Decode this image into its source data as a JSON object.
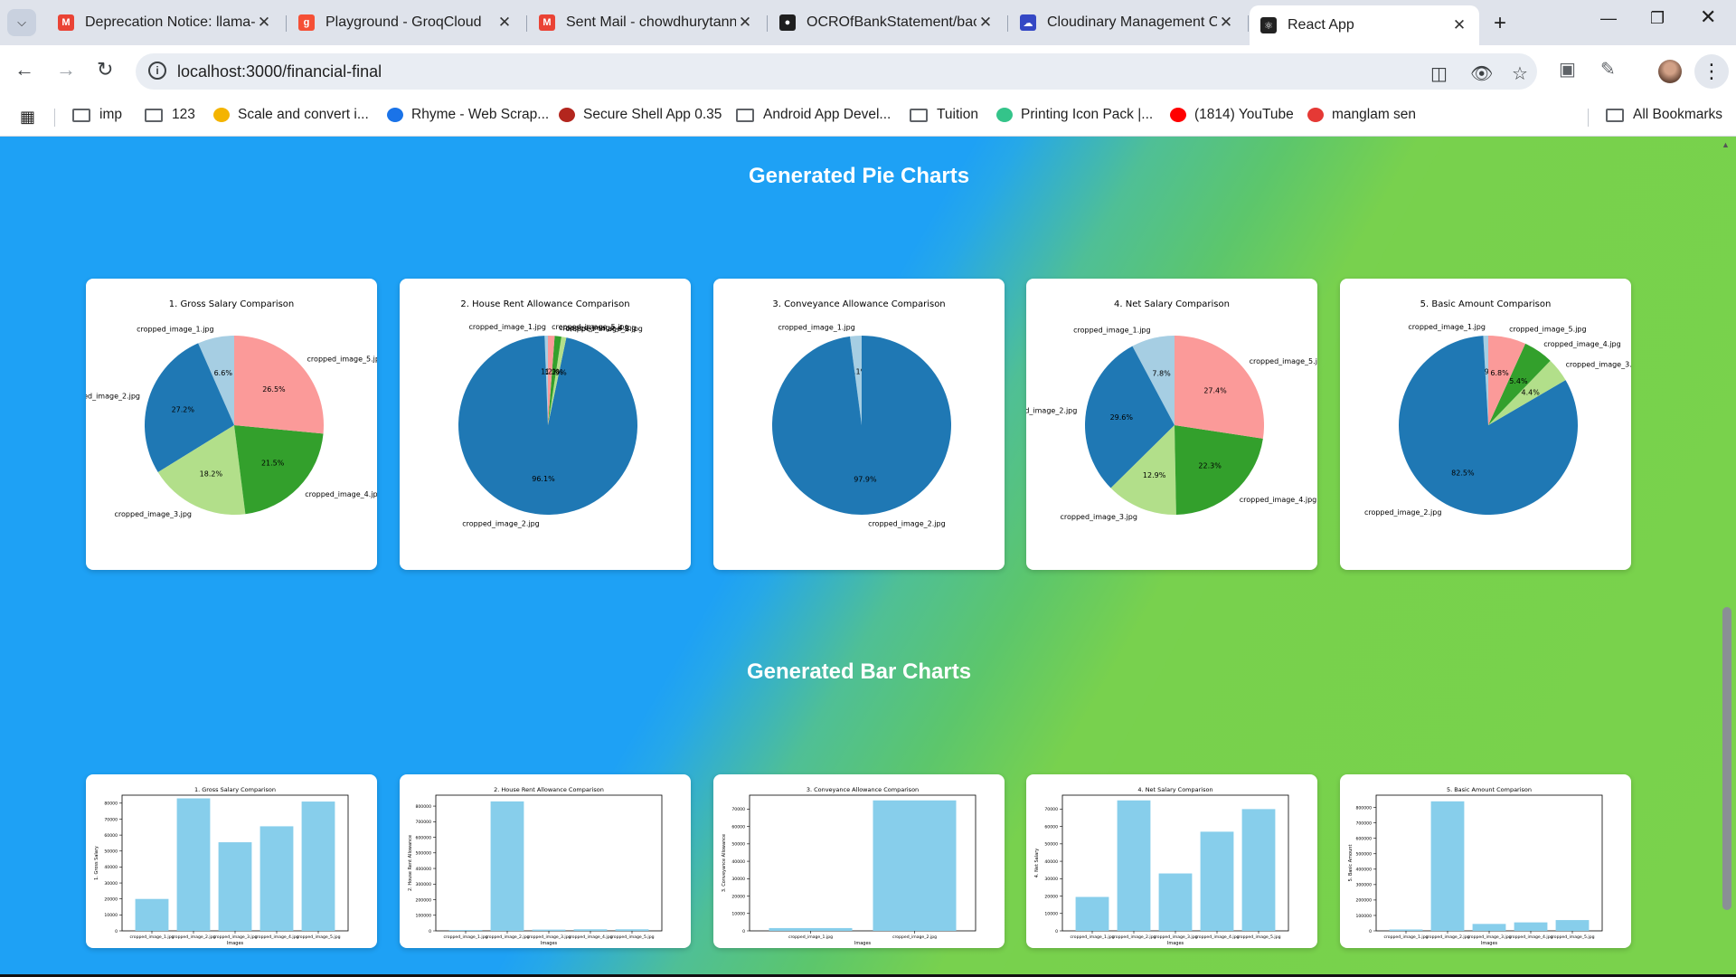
{
  "browser": {
    "tabs": [
      {
        "title": "Deprecation Notice: llama-",
        "icon": "gmail-icon",
        "color": "#ea4335",
        "left": 52
      },
      {
        "title": "Playground - GroqCloud",
        "icon": "groq-icon",
        "color": "#f55036",
        "left": 318
      },
      {
        "title": "Sent Mail - chowdhurytann",
        "icon": "gmail-icon",
        "color": "#ea4335",
        "left": 584
      },
      {
        "title": "OCROfBankStatement/bac",
        "icon": "github-icon",
        "color": "#1f1f1f",
        "left": 850
      },
      {
        "title": "Cloudinary Management C",
        "icon": "cloudinary-icon",
        "color": "#3448c5",
        "left": 1116
      },
      {
        "title": "React App",
        "icon": "react-icon",
        "color": "#222222",
        "left": 1382
      }
    ],
    "url": "localhost:3000/financial-final",
    "bookmarks": [
      {
        "label": "imp",
        "type": "folder"
      },
      {
        "label": "123",
        "type": "folder"
      },
      {
        "label": "Scale and convert i...",
        "type": "site",
        "color": "#f4b400"
      },
      {
        "label": "Rhyme - Web Scrap...",
        "type": "site",
        "color": "#1a73e8"
      },
      {
        "label": "Secure Shell App 0.35",
        "type": "site",
        "color": "#b3261e"
      },
      {
        "label": "Android App Devel...",
        "type": "folder"
      },
      {
        "label": "Tuition",
        "type": "folder"
      },
      {
        "label": "Printing Icon Pack |...",
        "type": "site",
        "color": "#34c48a"
      },
      {
        "label": "(1814) YouTube",
        "type": "site",
        "color": "#ff0000"
      },
      {
        "label": "manglam sen",
        "type": "site",
        "color": "#e53935"
      }
    ],
    "all_bookmarks": "All Bookmarks"
  },
  "page": {
    "pie_section_title": "Generated Pie Charts",
    "bar_section_title": "Generated Bar Charts"
  },
  "colors": {
    "c1": "#a6cee3",
    "c2": "#1f78b4",
    "c3": "#b2df8a",
    "c4": "#33a02c",
    "c5": "#fb9a99",
    "bar": "#87ceeb"
  },
  "chart_data": [
    {
      "type": "pie",
      "title": "1. Gross Salary Comparison",
      "labels": [
        "cropped_image_1.jpg",
        "cropped_image_2.jpg",
        "cropped_image_3.jpg",
        "cropped_image_4.jpg",
        "cropped_image_5.jpg"
      ],
      "values": [
        6.6,
        27.2,
        18.2,
        21.5,
        26.5
      ],
      "pct_labels": [
        "6.6%",
        "27.2%",
        "18.2%",
        "21.5%",
        "26.5%"
      ]
    },
    {
      "type": "pie",
      "title": "2. House Rent Allowance Comparison",
      "labels": [
        "cropped_image_1.jpg",
        "cropped_image_2.jpg",
        "cropped_image_3.jpg",
        "cropped_image_4.jpg",
        "cropped_image_5.jpg"
      ],
      "values": [
        0.6,
        96.1,
        0.9,
        1.2,
        1.2
      ],
      "pct_labels": [
        "0.6%",
        "96.1%",
        "0.9%",
        "1.2%",
        "1.2%"
      ]
    },
    {
      "type": "pie",
      "title": "3. Conveyance Allowance Comparison",
      "labels": [
        "cropped_image_1.jpg",
        "cropped_image_2.jpg"
      ],
      "values": [
        2.1,
        97.9
      ],
      "pct_labels": [
        "2.1%",
        "97.9%"
      ]
    },
    {
      "type": "pie",
      "title": "4. Net Salary Comparison",
      "labels": [
        "cropped_image_1.jpg",
        "cropped_image_2.jpg",
        "cropped_image_3.jpg",
        "cropped_image_4.jpg",
        "cropped_image_5.jpg"
      ],
      "values": [
        7.8,
        29.6,
        12.9,
        22.3,
        27.4
      ],
      "pct_labels": [
        "7.8%",
        "29.6%",
        "12.9%",
        "22.3%",
        "27.4%"
      ]
    },
    {
      "type": "pie",
      "title": "5. Basic Amount Comparison",
      "labels": [
        "cropped_image_1.jpg",
        "cropped_image_2.jpg",
        "cropped_image_3.jpg",
        "cropped_image_4.jpg",
        "cropped_image_5.jpg"
      ],
      "values": [
        0.9,
        82.5,
        4.4,
        5.4,
        6.8
      ],
      "pct_labels": [
        "0.9%",
        "82.5%",
        "4.4%",
        "5.4%",
        "6.8%"
      ]
    },
    {
      "type": "bar",
      "title": "1. Gross Salary Comparison",
      "xlabel": "Images",
      "ylabel": "1. Gross Salary",
      "categories": [
        "cropped_image_1.jpg",
        "cropped_image_2.jpg",
        "cropped_image_3.jpg",
        "cropped_image_4.jpg",
        "cropped_image_5.jpg"
      ],
      "values": [
        20000,
        83000,
        55500,
        65500,
        81000
      ],
      "ylim": [
        0,
        85000
      ],
      "yticks": [
        0,
        10000,
        20000,
        30000,
        40000,
        50000,
        60000,
        70000,
        80000
      ]
    },
    {
      "type": "bar",
      "title": "2. House Rent Allowance Comparison",
      "xlabel": "Images",
      "ylabel": "2. House Rent Allowance",
      "categories": [
        "cropped_image_1.jpg",
        "cropped_image_2.jpg",
        "cropped_image_3.jpg",
        "cropped_image_4.jpg",
        "cropped_image_5.jpg"
      ],
      "values": [
        5500,
        830000,
        8000,
        10000,
        10000
      ],
      "ylim": [
        0,
        870000
      ],
      "yticks": [
        0,
        100000,
        200000,
        300000,
        400000,
        500000,
        600000,
        700000,
        800000
      ]
    },
    {
      "type": "bar",
      "title": "3. Conveyance Allowance Comparison",
      "xlabel": "Images",
      "ylabel": "3. Conveyance Allowance",
      "categories": [
        "cropped_image_1.jpg",
        "cropped_image_2.jpg"
      ],
      "values": [
        1600,
        75000
      ],
      "ylim": [
        0,
        78000
      ],
      "yticks": [
        0,
        10000,
        20000,
        30000,
        40000,
        50000,
        60000,
        70000
      ]
    },
    {
      "type": "bar",
      "title": "4. Net Salary Comparison",
      "xlabel": "Images",
      "ylabel": "4. Net Salary",
      "categories": [
        "cropped_image_1.jpg",
        "cropped_image_2.jpg",
        "cropped_image_3.jpg",
        "cropped_image_4.jpg",
        "cropped_image_5.jpg"
      ],
      "values": [
        19500,
        75000,
        33000,
        57000,
        70000
      ],
      "ylim": [
        0,
        78000
      ],
      "yticks": [
        0,
        10000,
        20000,
        30000,
        40000,
        50000,
        60000,
        70000
      ]
    },
    {
      "type": "bar",
      "title": "5. Basic Amount Comparison",
      "xlabel": "Images",
      "ylabel": "5. Basic Amount",
      "categories": [
        "cropped_image_1.jpg",
        "cropped_image_2.jpg",
        "cropped_image_3.jpg",
        "cropped_image_4.jpg",
        "cropped_image_5.jpg"
      ],
      "values": [
        9000,
        840000,
        45000,
        55000,
        70000
      ],
      "ylim": [
        0,
        880000
      ],
      "yticks": [
        0,
        100000,
        200000,
        300000,
        400000,
        500000,
        600000,
        700000,
        800000
      ]
    }
  ]
}
